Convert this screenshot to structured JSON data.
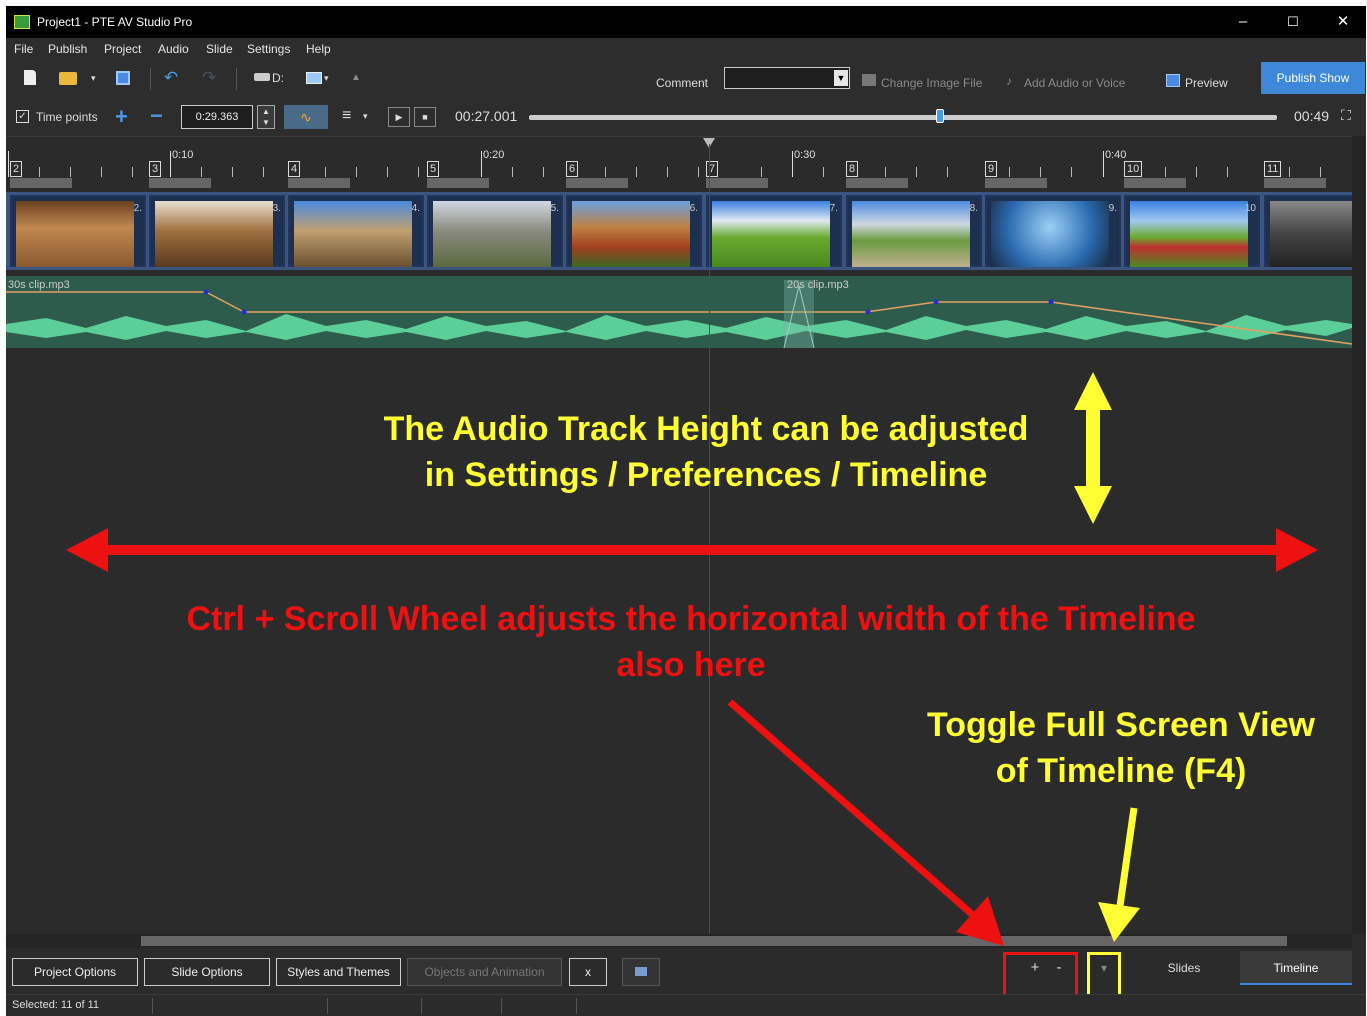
{
  "window": {
    "title": "Project1 - PTE AV Studio Pro",
    "min": "–",
    "max": "☐",
    "close": "✕"
  },
  "menu": [
    "File",
    "Publish",
    "Project",
    "Audio",
    "Slide",
    "Settings",
    "Help"
  ],
  "toolbar": {
    "drive": "D:",
    "comment_label": "Comment",
    "comment_value": "",
    "change_image": "Change Image File",
    "add_audio": "Add Audio or Voice",
    "preview": "Preview",
    "publish_show": "Publish Show"
  },
  "timepoints": {
    "label": "Time points",
    "time_value": "0:29.363",
    "current_time": "00:27.001",
    "total_time": "00:49",
    "progress": 0.55
  },
  "ruler": {
    "labels": [
      "0:10",
      "0:20",
      "0:30",
      "0:40"
    ]
  },
  "slides": [
    {
      "num": "2",
      "idx": "2."
    },
    {
      "num": "3",
      "idx": "3."
    },
    {
      "num": "4",
      "idx": "4."
    },
    {
      "num": "5",
      "idx": "5."
    },
    {
      "num": "6",
      "idx": "6."
    },
    {
      "num": "7",
      "idx": "7."
    },
    {
      "num": "8",
      "idx": "8."
    },
    {
      "num": "9",
      "idx": "9."
    },
    {
      "num": "10",
      "idx": "10"
    },
    {
      "num": "11",
      "idx": ""
    }
  ],
  "audio": {
    "clip1": "30s clip.mp3",
    "clip2": "20s clip.mp3"
  },
  "annotations": {
    "height_line1": "The Audio Track Height can be adjusted",
    "height_line2": "in Settings / Preferences / Timeline",
    "width_line1": "Ctrl + Scroll Wheel adjusts the horizontal width of the Timeline",
    "width_line2": "also here",
    "toggle_line1": "Toggle Full Screen View",
    "toggle_line2": "of Timeline (F4)"
  },
  "bottom": {
    "project_options": "Project Options",
    "slide_options": "Slide Options",
    "styles_themes": "Styles and Themes",
    "objects_animation": "Objects and Animation",
    "x": "x",
    "zoom_plus": "+",
    "zoom_minus": "-",
    "toggle": "▾",
    "tab_slides": "Slides",
    "tab_timeline": "Timeline"
  },
  "status": {
    "selected": "Selected: 11 of 11"
  },
  "colors": {
    "annotation_yellow": "#ffff33",
    "annotation_red": "#ee1111",
    "accent": "#3e88d9",
    "waveform": "#5ccf98"
  }
}
